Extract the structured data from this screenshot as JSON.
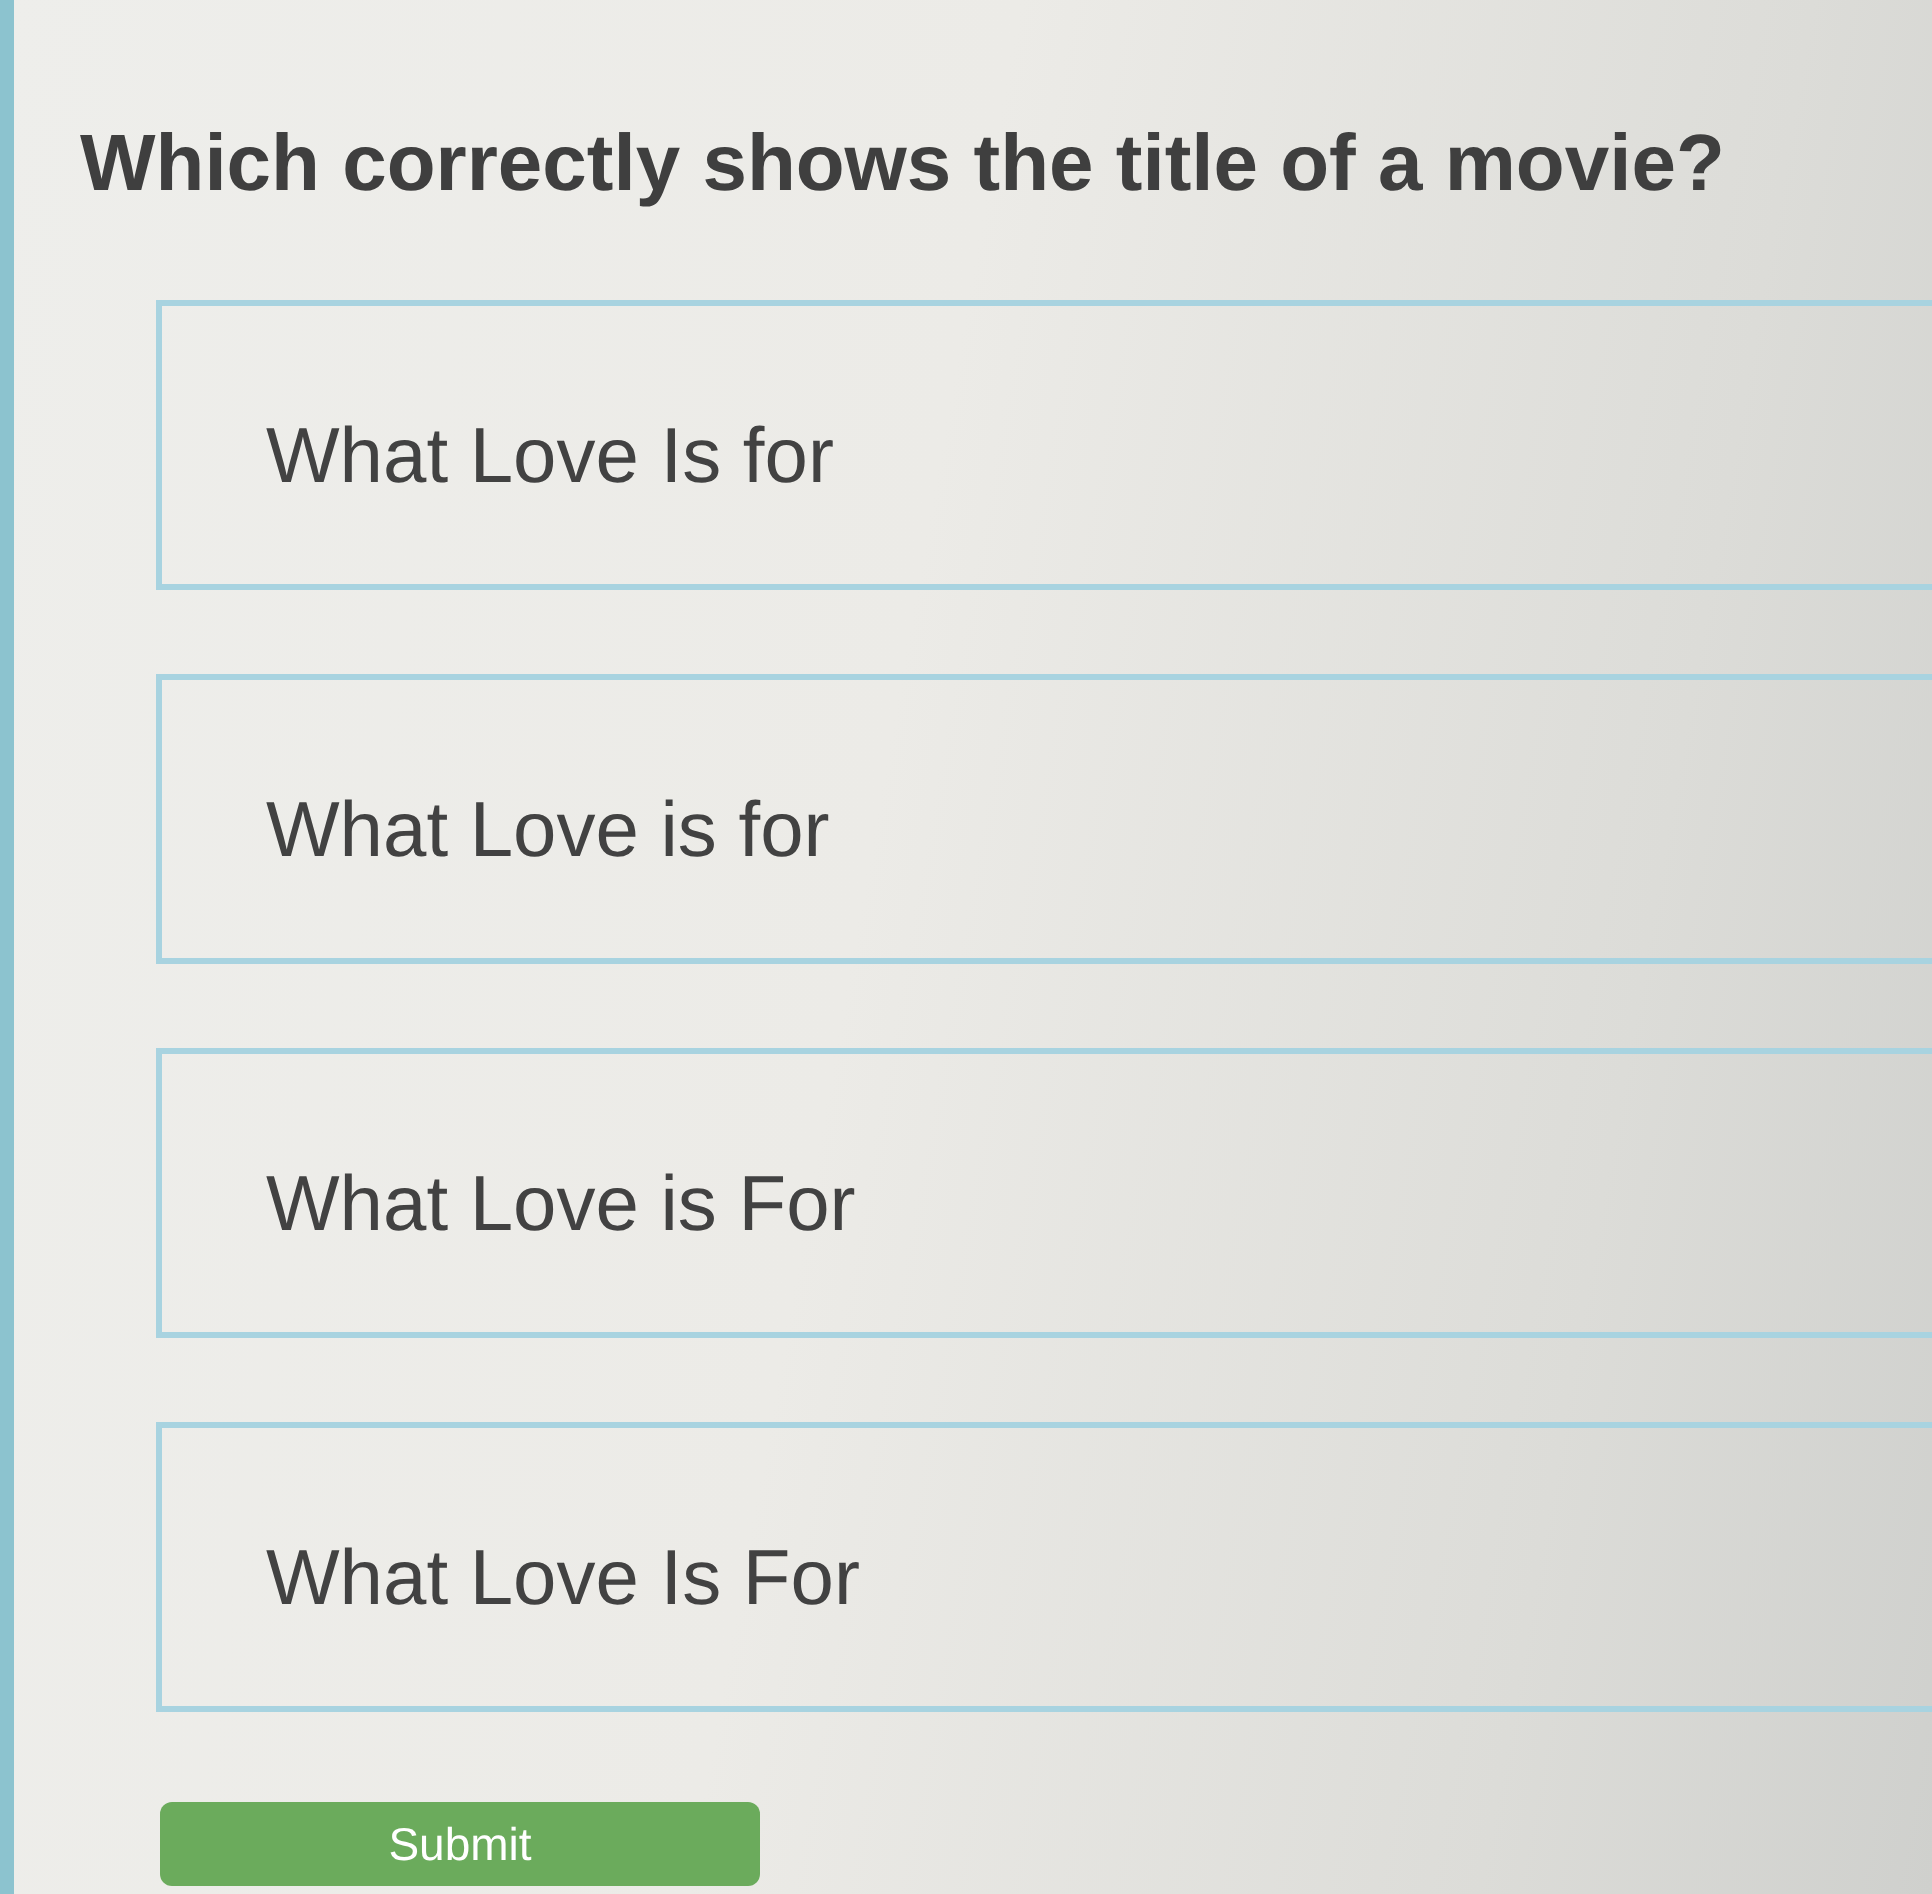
{
  "question": {
    "text": "Which correctly shows the title of a movie?"
  },
  "options": [
    {
      "label": "What Love Is for",
      "selected": false
    },
    {
      "label": "What Love is for",
      "selected": false
    },
    {
      "label": "What Love is For",
      "selected": false
    },
    {
      "label": "What Love Is For",
      "selected": false
    }
  ],
  "submit_button": {
    "label": "Submit"
  }
}
